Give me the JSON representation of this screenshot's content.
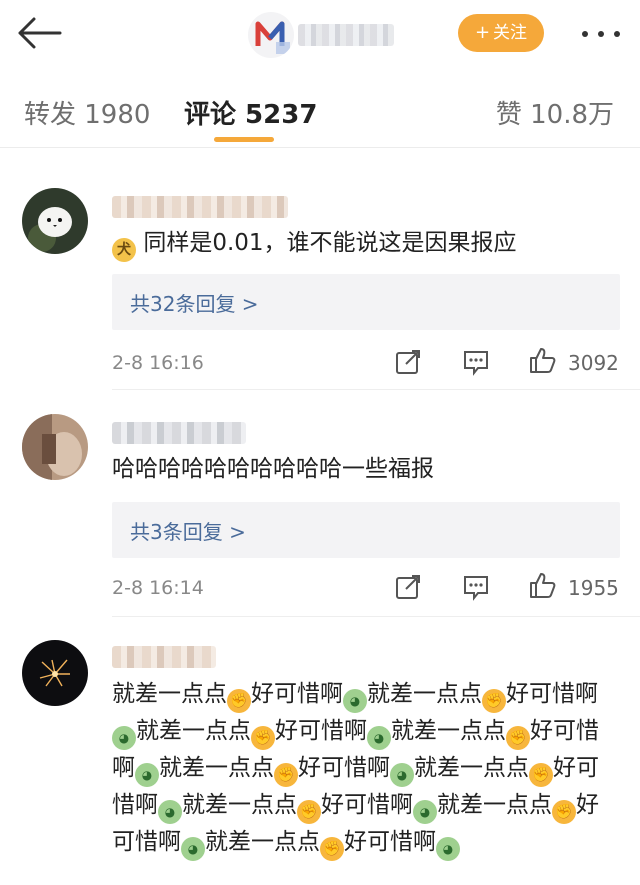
{
  "header": {
    "follow_label": "关注",
    "follow_plus": "+"
  },
  "tabs": {
    "forward": "转发 1980",
    "comment": "评论 5237",
    "like": "赞 10.8万"
  },
  "colors": {
    "accent": "#f5a83a",
    "reply_link": "#4a6b9a",
    "reply_bg": "#f3f3f5"
  },
  "comments": [
    {
      "text": "同样是0.01，谁不能说这是因果报应",
      "emoji_icon": "doge-emoji-icon",
      "replies": "共32条回复 >",
      "time": "2-8 16:16",
      "likes": "3092"
    },
    {
      "text": "哈哈哈哈哈哈哈哈哈哈一些福报",
      "replies": "共3条回复 >",
      "time": "2-8 16:14",
      "likes": "1955"
    },
    {
      "segments": [
        "就差一点点",
        "好可惜啊",
        "就差一点点",
        "好可惜啊",
        "就差一点点",
        "好可惜啊",
        "就差一点点",
        "好可惜啊",
        "就差一点点",
        "好可惜啊",
        "就差一点点",
        "好可惜啊",
        "就差一点点",
        "好可惜啊",
        "就差一点点",
        "好可惜啊",
        "就差一点点",
        "好可惜啊"
      ],
      "emoji_icons": [
        "hand-emoji-icon",
        "crying-emoji-icon"
      ]
    }
  ]
}
